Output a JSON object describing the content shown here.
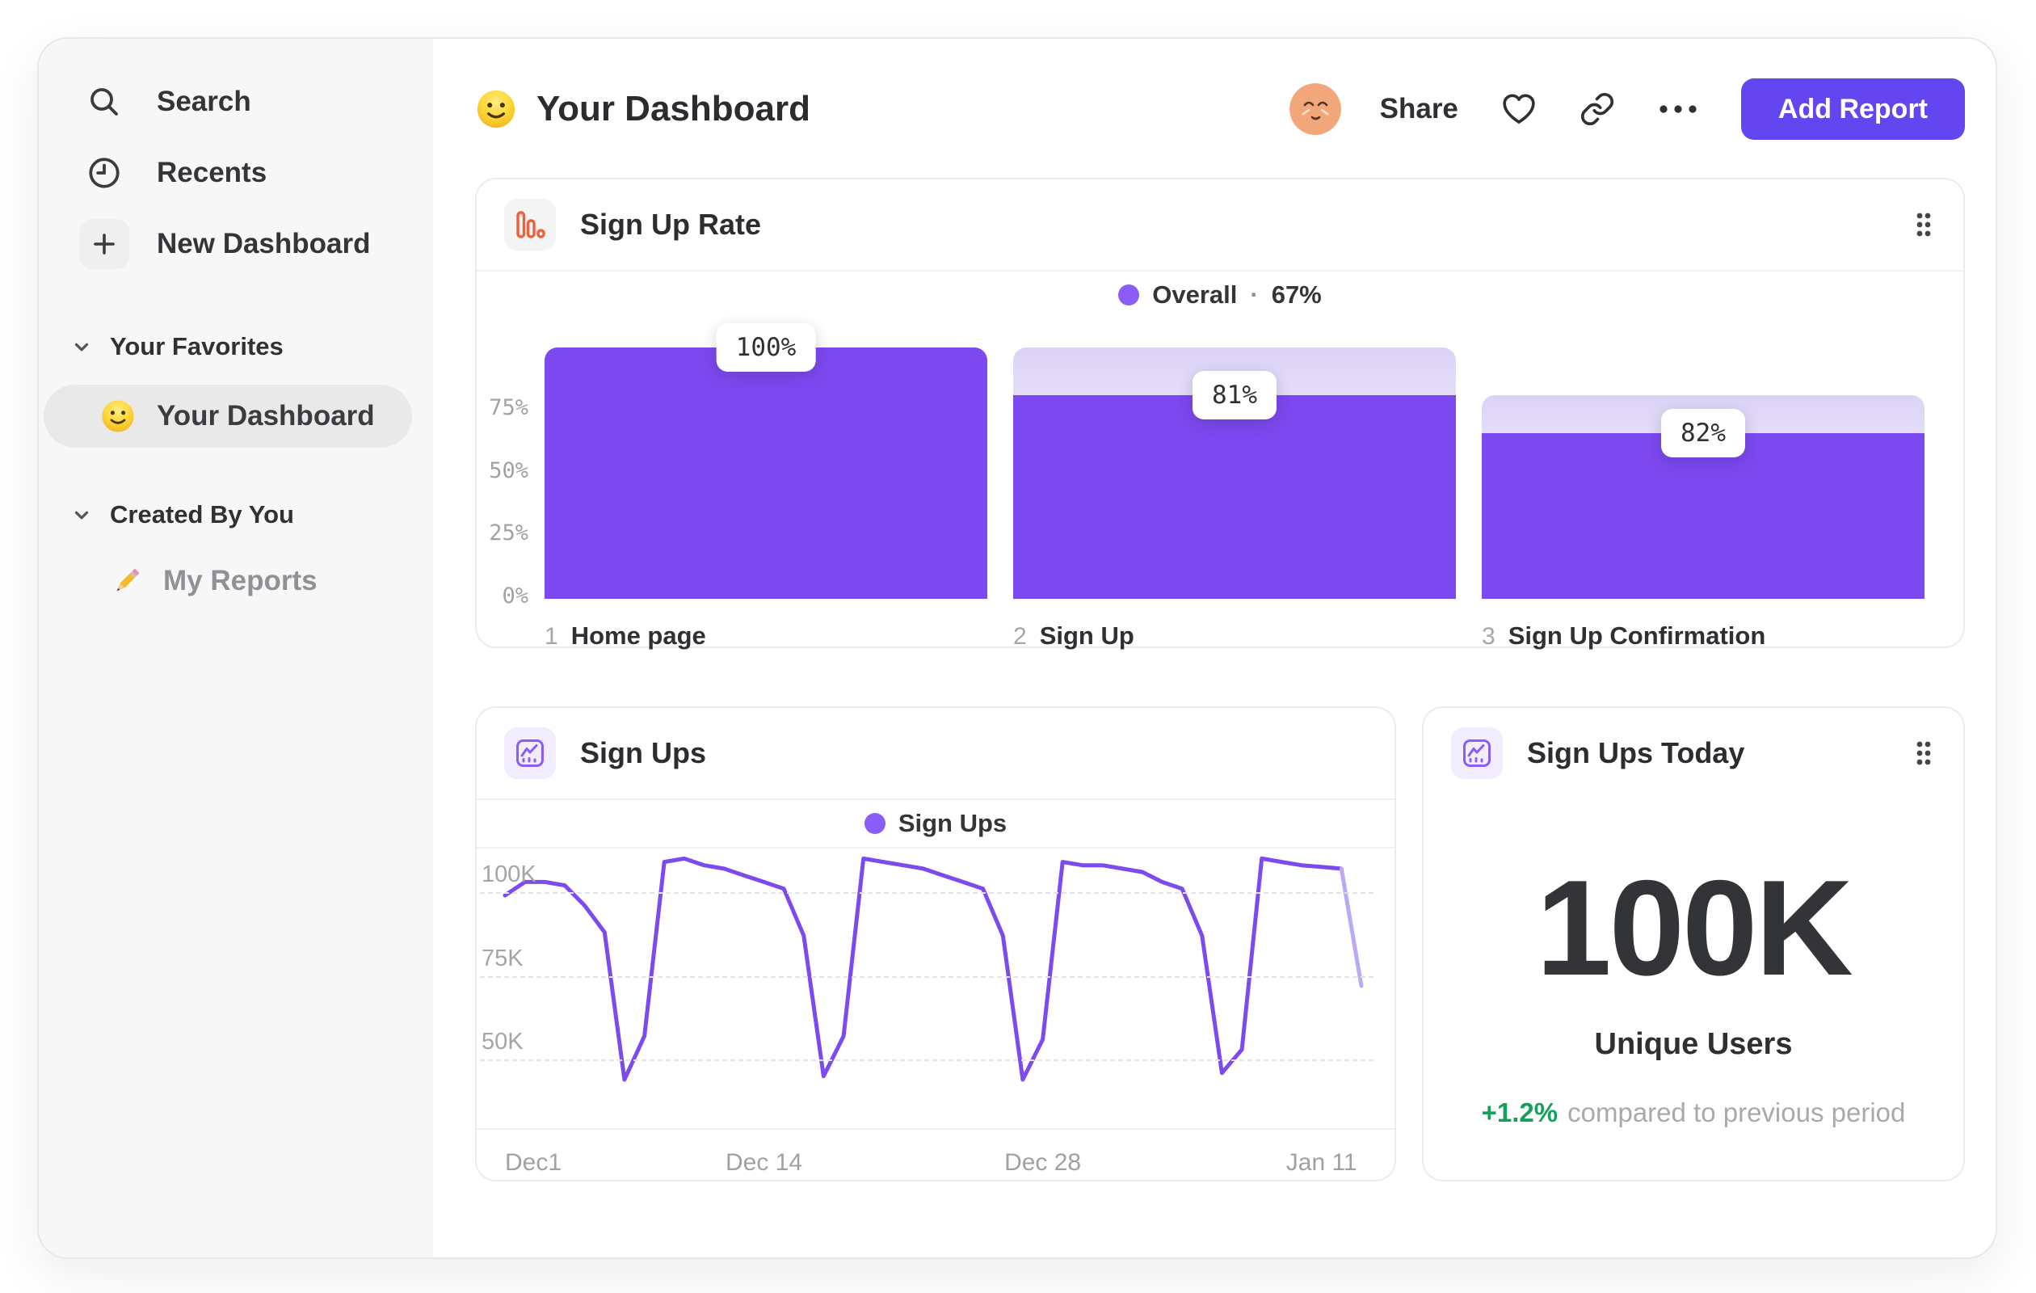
{
  "sidebar": {
    "nav": [
      {
        "label": "Search",
        "icon": "search-icon"
      },
      {
        "label": "Recents",
        "icon": "clock-icon"
      },
      {
        "label": "New Dashboard",
        "icon": "plus-icon"
      }
    ],
    "sections": [
      {
        "title": "Your Favorites",
        "items": [
          {
            "label": "Your Dashboard",
            "emoji": "smiley-emoji",
            "selected": true
          }
        ]
      },
      {
        "title": "Created By You",
        "items": [
          {
            "label": "My Reports",
            "emoji": "pencil-emoji",
            "selected": false
          }
        ]
      }
    ]
  },
  "header": {
    "title": "Your Dashboard",
    "share_label": "Share",
    "add_report_label": "Add Report"
  },
  "colors": {
    "accent_purple": "#7C48F0",
    "legend_purple": "#8B5CF6",
    "button_purple": "#6446F0",
    "positive_green": "#14A05A",
    "funnel_icon_orange": "#EF5F3C"
  },
  "chart_data": [
    {
      "id": "signup_rate",
      "type": "bar",
      "title": "Sign Up Rate",
      "legend": {
        "label": "Overall",
        "separator": "·",
        "value": "67%"
      },
      "step_numbers": [
        "1",
        "2",
        "3"
      ],
      "categories": [
        "Home page",
        "Sign Up",
        "Sign Up Confirmation"
      ],
      "values_pct": [
        100,
        81,
        66
      ],
      "prev_pct": [
        100,
        100,
        81
      ],
      "conversion_labels": [
        "100%",
        "81%",
        "82%"
      ],
      "yticks": [
        {
          "label": "75%",
          "value": 75
        },
        {
          "label": "50%",
          "value": 50
        },
        {
          "label": "25%",
          "value": 25
        },
        {
          "label": "0%",
          "value": 0
        }
      ],
      "ylim": [
        0,
        100
      ],
      "bar_color": "#7C48F0"
    },
    {
      "id": "sign_ups",
      "type": "line",
      "title": "Sign Ups",
      "legend": {
        "label": "Sign Ups"
      },
      "x_start": "Dec 1",
      "xticks": [
        {
          "label": "Dec1",
          "day": 0
        },
        {
          "label": "Dec 14",
          "day": 13
        },
        {
          "label": "Dec 28",
          "day": 27
        },
        {
          "label": "Jan 11",
          "day": 41
        }
      ],
      "yticks": [
        {
          "label": "100K",
          "value": 100
        },
        {
          "label": "75K",
          "value": 75
        },
        {
          "label": "50K",
          "value": 50
        }
      ],
      "values_k": [
        99,
        103,
        103,
        102,
        96,
        88,
        44,
        57,
        109,
        110,
        108,
        107,
        105,
        103,
        101,
        87,
        45,
        57,
        110,
        109,
        108,
        107,
        105,
        103,
        101,
        87,
        44,
        56,
        109,
        108,
        108,
        107,
        106,
        103,
        101,
        87,
        46,
        53,
        110,
        109,
        108,
        107.5,
        107,
        72
      ],
      "faded_from_index": 42,
      "ylim": [
        30,
        113
      ],
      "line_color": "#7B4BEF",
      "faded_color": "#BCA9F6"
    },
    {
      "id": "sign_ups_today",
      "type": "kpi",
      "title": "Sign Ups Today",
      "value": "100K",
      "label": "Unique Users",
      "delta": "+1.2%",
      "comparison": "compared to previous period"
    }
  ]
}
